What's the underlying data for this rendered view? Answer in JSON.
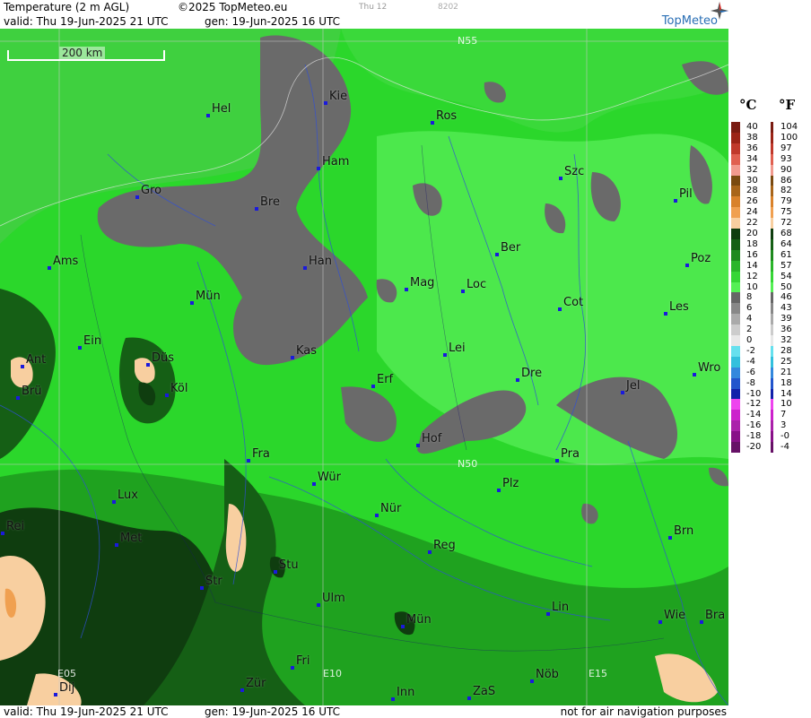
{
  "header": {
    "title": "Temperature (2 m AGL)",
    "copyright": "©2025 TopMeteo.eu",
    "model": "Thu 12",
    "code": "8202",
    "valid": "valid:  Thu  19-Jun-2025  21 UTC",
    "generated": "gen: 19-Jun-2025 16 UTC",
    "logo": "TopMeteo"
  },
  "footer": {
    "valid": "valid:  Thu  19-Jun-2025  21 UTC",
    "generated": "gen: 19-Jun-2025 16 UTC",
    "note": "not for air navigation purposes"
  },
  "map": {
    "scale_label": "200 km",
    "grid_labels": [
      "N55",
      "N50",
      "E05",
      "E10",
      "E15"
    ],
    "cities": [
      "Hel",
      "Kie",
      "Ros",
      "Ham",
      "Szc",
      "Gro",
      "Bre",
      "Pil",
      "Ber",
      "Ams",
      "Han",
      "Poz",
      "Mag",
      "Loc",
      "Mün",
      "Cot",
      "Les",
      "Ein",
      "Kas",
      "Lei",
      "Ant",
      "Düs",
      "Wro",
      "Erf",
      "Dre",
      "Brü",
      "Köl",
      "Jel",
      "Hof",
      "Fra",
      "Pra",
      "Wür",
      "Plz",
      "Lux",
      "Nür",
      "Rei",
      "Met",
      "Brn",
      "Reg",
      "Stu",
      "Str",
      "Ulm",
      "Lin",
      "Mün",
      "Wie",
      "Bra",
      "Fri",
      "Nöb",
      "Inn",
      "ZaS",
      "Zür",
      "Dij"
    ]
  },
  "legend": {
    "celsius_unit": "°C",
    "fahrenheit_unit": "°F",
    "celsius": [
      "40",
      "38",
      "36",
      "34",
      "32",
      "30",
      "28",
      "26",
      "24",
      "22",
      "20",
      "18",
      "16",
      "14",
      "12",
      "10",
      "8",
      "6",
      "4",
      "2",
      "0",
      "-2",
      "-4",
      "-6",
      "-8",
      "-10",
      "-12",
      "-14",
      "-16",
      "-18",
      "-20"
    ],
    "fahrenheit": [
      "104",
      "100",
      "97",
      "93",
      "90",
      "86",
      "82",
      "79",
      "75",
      "72",
      "68",
      "64",
      "61",
      "57",
      "54",
      "50",
      "46",
      "43",
      "39",
      "36",
      "32",
      "28",
      "25",
      "21",
      "18",
      "14",
      "10",
      "7",
      "3",
      "-0",
      "-4"
    ],
    "colors": [
      "#7a1c12",
      "#9b2417",
      "#c0392b",
      "#e06050",
      "#f19a8e",
      "#7a4a10",
      "#a8651a",
      "#d9822b",
      "#f0a050",
      "#f8cfa0",
      "#0f3d0f",
      "#155f15",
      "#1f8a1f",
      "#2bb52b",
      "#36d636",
      "#55f055",
      "#666666",
      "#888888",
      "#aaaaaa",
      "#cccccc",
      "#e8e8e8",
      "#66e0ee",
      "#33c0dd",
      "#3388dd",
      "#2255cc",
      "#1122aa",
      "#ee44ee",
      "#cc22cc",
      "#aa22aa",
      "#881188",
      "#661166"
    ]
  }
}
